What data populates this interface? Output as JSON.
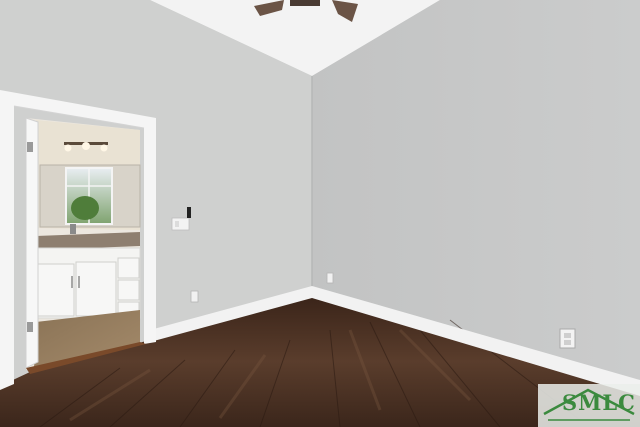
{
  "watermark": {
    "text": "SMLC",
    "color": "#3b8a3e"
  },
  "colors": {
    "left_wall": "#cfd0cf",
    "right_wall": "#c5c6c6",
    "ceiling": "#f3f3f3",
    "floor": "#4a3225",
    "baseboard": "#f2f2f2",
    "door_trim": "#f5f5f5"
  },
  "icons": [
    "ceiling-fan-icon",
    "light-switch-icon",
    "outlet-icon",
    "vanity-light-icon",
    "window-icon"
  ]
}
